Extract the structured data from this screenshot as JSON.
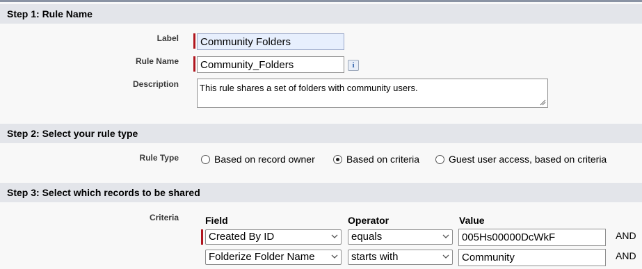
{
  "step1": {
    "header": "Step 1: Rule Name",
    "label_caption": "Label",
    "label_value": "Community Folders",
    "rule_name_caption": "Rule Name",
    "rule_name_value": "Community_Folders",
    "info_icon_glyph": "i",
    "description_caption": "Description",
    "description_value": "This rule shares a set of folders with community users."
  },
  "step2": {
    "header": "Step 2: Select your rule type",
    "rule_type_caption": "Rule Type",
    "options": [
      {
        "label": "Based on record owner",
        "checked": false
      },
      {
        "label": "Based on criteria",
        "checked": true
      },
      {
        "label": "Guest user access, based on criteria",
        "checked": false
      }
    ]
  },
  "step3": {
    "header": "Step 3: Select which records to be shared",
    "criteria_caption": "Criteria",
    "columns": {
      "field": "Field",
      "operator": "Operator",
      "value": "Value"
    },
    "rows": [
      {
        "field": "Created By ID",
        "operator": "equals",
        "value": "005Hs00000DcWkF",
        "conjunction": "AND"
      },
      {
        "field": "Folderize Folder Name",
        "operator": "starts with",
        "value": "Community",
        "conjunction": "AND"
      }
    ]
  },
  "colors": {
    "required": "#b0161f",
    "header_bg": "#e3e5ea",
    "focused_input": "#e7effd"
  },
  "icons": {
    "info": "info-icon",
    "dropdown": "chevron-down-icon",
    "resize": "resize-grip-icon"
  }
}
